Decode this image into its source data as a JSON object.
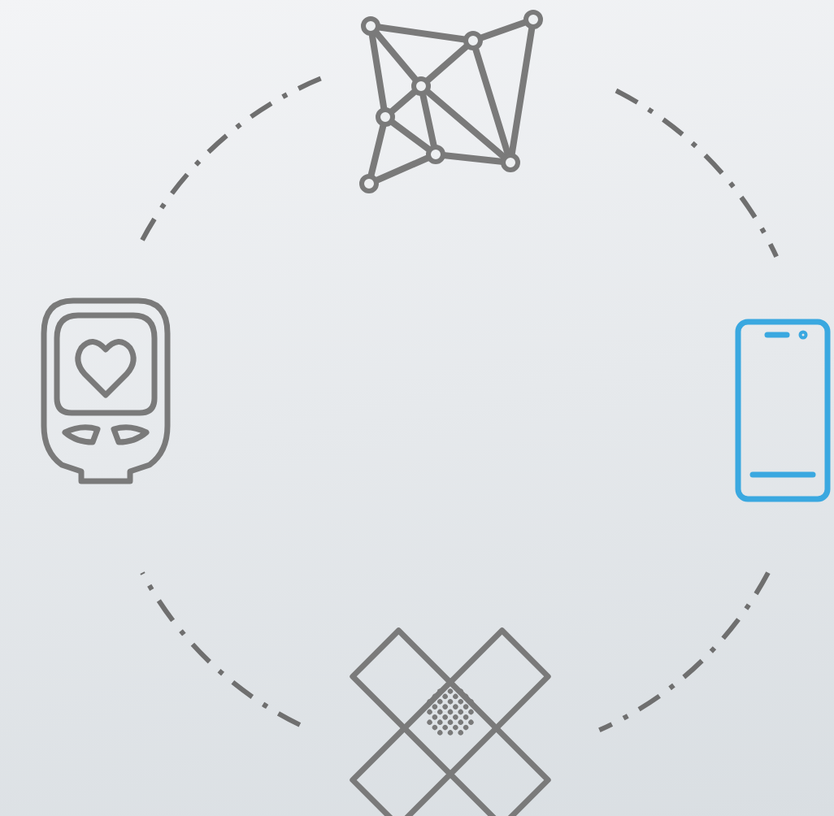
{
  "diagram": {
    "nodes": [
      {
        "kind": "network",
        "color": "#7a7a7a"
      },
      {
        "kind": "glucose_meter",
        "color": "#7a7a7a"
      },
      {
        "kind": "phone",
        "color": "#3aa8e0"
      },
      {
        "kind": "bandage",
        "color": "#7a7a7a"
      }
    ]
  }
}
